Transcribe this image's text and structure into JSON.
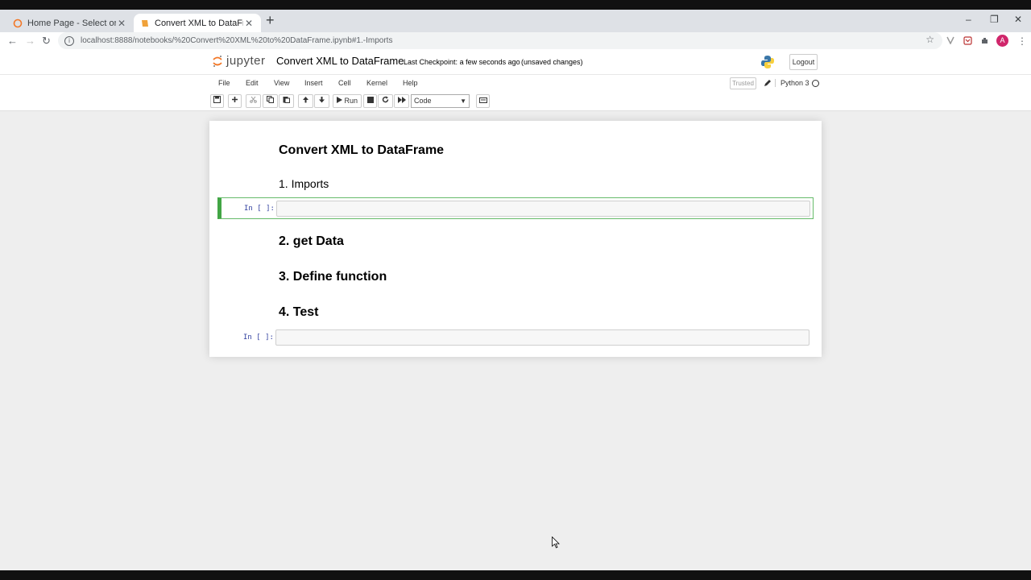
{
  "browser": {
    "tabs": [
      {
        "title": "Home Page - Select or create a n",
        "active": false,
        "close": "✕"
      },
      {
        "title": "Convert XML to DataFrame - Jup",
        "active": true,
        "close": "✕"
      }
    ],
    "new_tab": "+",
    "window_controls": {
      "minimize": "–",
      "restore": "❐",
      "close": "✕"
    },
    "nav": {
      "back": "←",
      "forward": "→",
      "reload": "↻"
    },
    "url": "localhost:8888/notebooks/%20Convert%20XML%20to%20DataFrame.ipynb#1.-Imports",
    "info_icon": "i",
    "star_icon": "☆",
    "avatar_initial": "A",
    "menu_icon": "⋮"
  },
  "jupyter": {
    "wordmark": "jupyter",
    "notebook_title": "Convert XML to DataFrame",
    "checkpoint_label": "Last Checkpoint:",
    "checkpoint_time": "a few seconds ago",
    "unsaved": "(unsaved changes)",
    "logout": "Logout",
    "menu": [
      "File",
      "Edit",
      "View",
      "Insert",
      "Cell",
      "Kernel",
      "Help"
    ],
    "trusted": "Trusted",
    "kernel_name": "Python 3",
    "toolbar": {
      "run_label": "Run",
      "cell_type": "Code"
    },
    "accent_color": "#42a545"
  },
  "cells": {
    "title": "Convert XML to DataFrame",
    "imports": "1. Imports",
    "get_data": "2. get Data",
    "define_function": "3. Define function",
    "test": "4. Test",
    "prompt": "In [ ]:"
  }
}
